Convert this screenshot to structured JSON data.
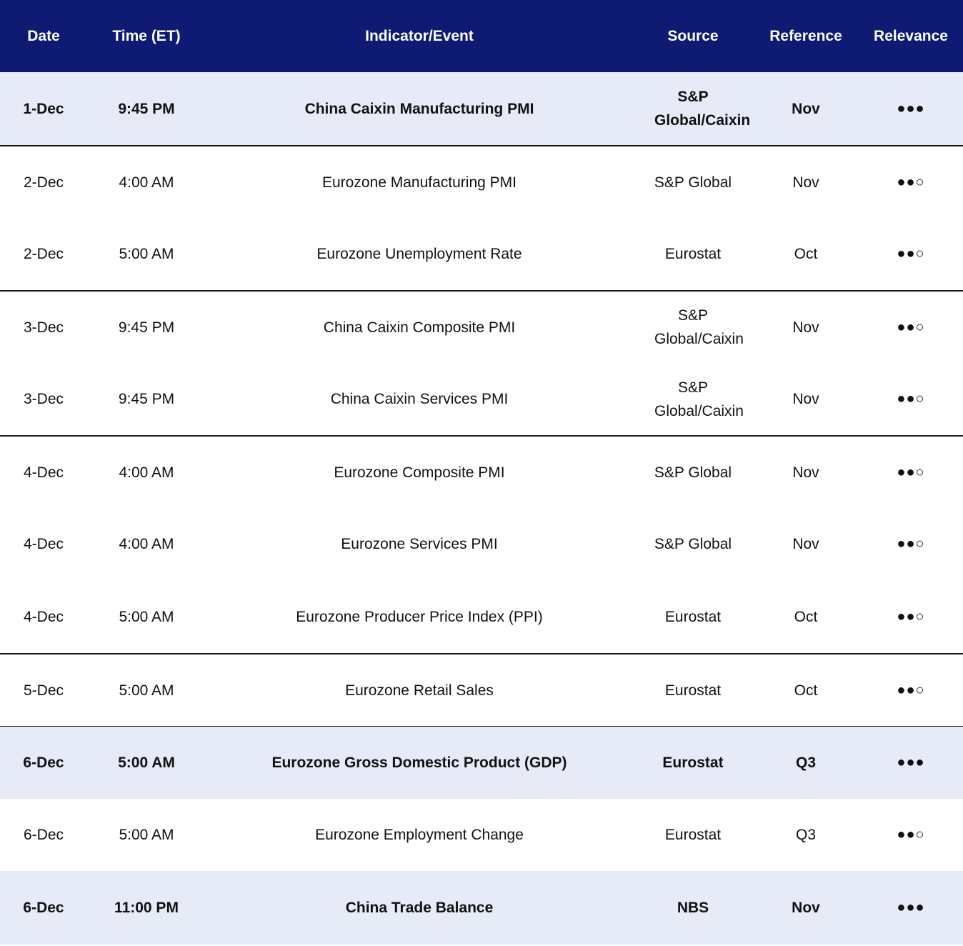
{
  "header": {
    "date": "Date",
    "time": "Time (ET)",
    "event": "Indicator/Event",
    "source": "Source",
    "reference": "Reference",
    "relevance": "Relevance"
  },
  "colors": {
    "header_bg": "#0f1a73",
    "highlight_bg": "#e6ebf7"
  },
  "rows": [
    {
      "date": "1-Dec",
      "time": "9:45 PM",
      "event": "China Caixin Manufacturing PMI",
      "source": "S&P Global/Caixin",
      "reference": "Nov",
      "relevance": "●●●"
    },
    {
      "date": "2-Dec",
      "time": "4:00 AM",
      "event": "Eurozone Manufacturing PMI",
      "source": "S&P Global",
      "reference": "Nov",
      "relevance": "●●○"
    },
    {
      "date": "2-Dec",
      "time": "5:00 AM",
      "event": "Eurozone Unemployment Rate",
      "source": "Eurostat",
      "reference": "Oct",
      "relevance": "●●○"
    },
    {
      "date": "3-Dec",
      "time": "9:45 PM",
      "event": "China Caixin Composite PMI",
      "source": "S&P Global/Caixin",
      "reference": "Nov",
      "relevance": "●●○"
    },
    {
      "date": "3-Dec",
      "time": "9:45 PM",
      "event": "China Caixin Services PMI",
      "source": "S&P Global/Caixin",
      "reference": "Nov",
      "relevance": "●●○"
    },
    {
      "date": "4-Dec",
      "time": "4:00 AM",
      "event": "Eurozone Composite PMI",
      "source": "S&P Global",
      "reference": "Nov",
      "relevance": "●●○"
    },
    {
      "date": "4-Dec",
      "time": "4:00 AM",
      "event": "Eurozone Services PMI",
      "source": "S&P Global",
      "reference": "Nov",
      "relevance": "●●○"
    },
    {
      "date": "4-Dec",
      "time": "5:00 AM",
      "event": "Eurozone Producer Price Index (PPI)",
      "source": "Eurostat",
      "reference": "Oct",
      "relevance": "●●○"
    },
    {
      "date": "5-Dec",
      "time": "5:00 AM",
      "event": "Eurozone Retail Sales",
      "source": "Eurostat",
      "reference": "Oct",
      "relevance": "●●○"
    },
    {
      "date": "6-Dec",
      "time": "5:00 AM",
      "event": "Eurozone Gross Domestic Product (GDP)",
      "source": "Eurostat",
      "reference": "Q3",
      "relevance": "●●●"
    },
    {
      "date": "6-Dec",
      "time": "5:00 AM",
      "event": "Eurozone Employment Change",
      "source": "Eurostat",
      "reference": "Q3",
      "relevance": "●●○"
    },
    {
      "date": "6-Dec",
      "time": "11:00 PM",
      "event": "China Trade Balance",
      "source": "NBS",
      "reference": "Nov",
      "relevance": "●●●"
    }
  ]
}
